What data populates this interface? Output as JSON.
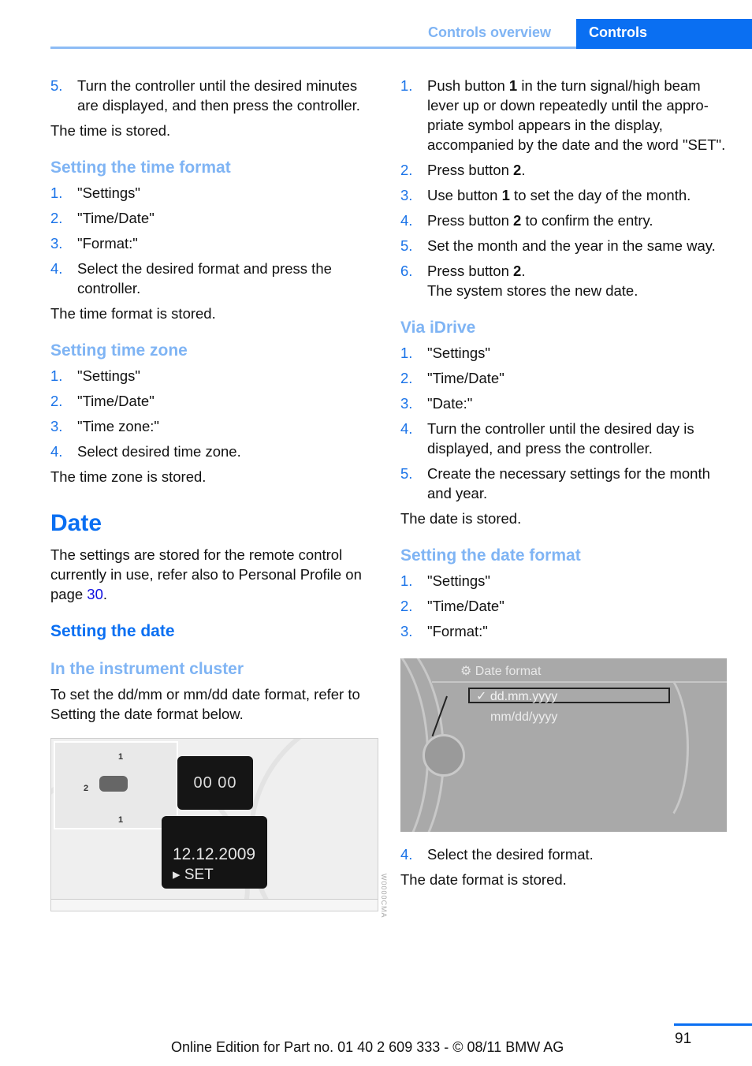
{
  "header": {
    "section": "Controls overview",
    "tab": "Controls"
  },
  "left": {
    "intro_item": {
      "num": "5.",
      "text": "Turn the controller until the desired minutes are displayed, and then press the controller."
    },
    "intro_result": "The time is stored.",
    "time_format": {
      "heading": "Setting the time format",
      "items": [
        {
          "num": "1.",
          "text": "\"Settings\""
        },
        {
          "num": "2.",
          "text": "\"Time/Date\""
        },
        {
          "num": "3.",
          "text": "\"Format:\""
        },
        {
          "num": "4.",
          "text": "Select the desired format and press the controller."
        }
      ],
      "result": "The time format is stored."
    },
    "time_zone": {
      "heading": "Setting time zone",
      "items": [
        {
          "num": "1.",
          "text": "\"Settings\""
        },
        {
          "num": "2.",
          "text": "\"Time/Date\""
        },
        {
          "num": "3.",
          "text": "\"Time zone:\""
        },
        {
          "num": "4.",
          "text": "Select desired time zone."
        }
      ],
      "result": "The time zone is stored."
    },
    "date": {
      "heading": "Date",
      "para_before_link": "The settings are stored for the remote control currently in use, refer also to Personal Profile on page ",
      "link": "30",
      "para_after_link": ".",
      "setting_heading": "Setting the date",
      "cluster_heading": "In the instrument cluster",
      "cluster_para": "To set the dd/mm or mm/dd date format, refer to Setting the date format below."
    },
    "figure": {
      "display_symbol": "00 00",
      "display_date": "12.12.2009",
      "display_set": "SET",
      "arrow_up": "1",
      "arrow_down": "1",
      "arrow_side": "2",
      "side_code": "W0000CMA"
    }
  },
  "right": {
    "cluster_steps": [
      {
        "num": "1.",
        "pre": "Push button ",
        "bold": "1",
        "post": " in the turn signal/high beam lever up or down repeatedly until the appro-priate symbol appears in the display, accompanied by the date and the word \"SET\"."
      },
      {
        "num": "2.",
        "pre": "Press button ",
        "bold": "2",
        "post": "."
      },
      {
        "num": "3.",
        "pre": "Use button ",
        "bold": "1",
        "post": " to set the day of the month."
      },
      {
        "num": "4.",
        "pre": "Press button ",
        "bold": "2",
        "post": " to confirm the entry."
      },
      {
        "num": "5.",
        "pre": "Set the month and the year in the same way.",
        "bold": "",
        "post": ""
      },
      {
        "num": "6.",
        "pre": "Press button ",
        "bold": "2",
        "post": ".",
        "note": "The system stores the new date."
      }
    ],
    "idrive": {
      "heading": "Via iDrive",
      "items": [
        {
          "num": "1.",
          "text": "\"Settings\""
        },
        {
          "num": "2.",
          "text": "\"Time/Date\""
        },
        {
          "num": "3.",
          "text": "\"Date:\""
        },
        {
          "num": "4.",
          "text": "Turn the controller until the desired day is displayed, and press the controller."
        },
        {
          "num": "5.",
          "text": "Create the necessary settings for the month and year."
        }
      ],
      "result": "The date is stored."
    },
    "date_format": {
      "heading": "Setting the date format",
      "items": [
        {
          "num": "1.",
          "text": "\"Settings\""
        },
        {
          "num": "2.",
          "text": "\"Time/Date\""
        },
        {
          "num": "3.",
          "text": "\"Format:\""
        }
      ],
      "screen": {
        "title": "Date format",
        "selected_option": "dd.mm.yyyy",
        "check": "✓",
        "other_option": "mm/dd/yyyy"
      },
      "after_items": [
        {
          "num": "4.",
          "text": "Select the desired format."
        }
      ],
      "result": "The date format is stored."
    }
  },
  "footer": {
    "text": "Online Edition for Part no. 01 40 2 609 333 - © 08/11 BMW AG",
    "page": "91"
  }
}
